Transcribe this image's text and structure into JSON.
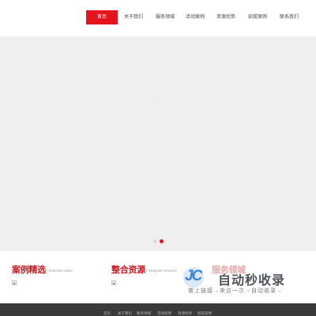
{
  "nav": {
    "items": [
      {
        "label": "首页",
        "active": true
      },
      {
        "label": "关于我们",
        "active": false
      },
      {
        "label": "服务领域",
        "active": false
      },
      {
        "label": "活动案例",
        "active": false
      },
      {
        "label": "资源优势",
        "active": false
      },
      {
        "label": "招揽案例",
        "active": false
      },
      {
        "label": "联系我们",
        "active": false
      }
    ]
  },
  "hero": {
    "current_slide": 2,
    "slide_count": 2
  },
  "sections": {
    "cases": {
      "title": "案例精选",
      "subtitle": "/ Selected cases"
    },
    "resources": {
      "title": "整合资源",
      "subtitle": "/ Integrate resource"
    },
    "services": {
      "title": "服务领域"
    }
  },
  "watermark": {
    "logo_text": "JC",
    "title": "自动秒收录",
    "slogan": "做上链接→来访一次→自动收录→"
  },
  "footer": {
    "links": [
      "首页",
      "关于我们",
      "服务领域",
      "活动案例",
      "资源优势",
      "招揽案例"
    ]
  },
  "colors": {
    "accent": "#e3141d",
    "section_title": "#c8161d",
    "hero_bg": "#efefef",
    "footer_bg": "#3a3a3a"
  }
}
